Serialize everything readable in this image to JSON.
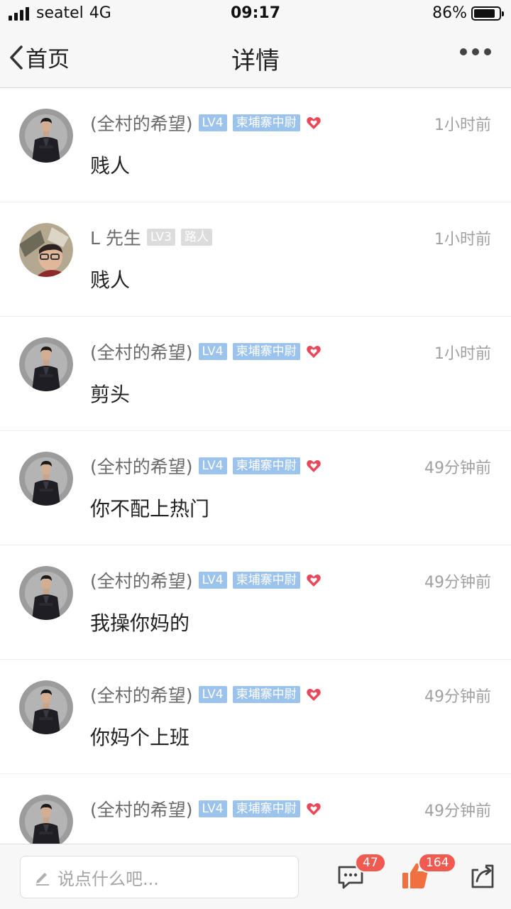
{
  "status_bar": {
    "carrier": "seatel",
    "network": "4G",
    "time": "09:17",
    "battery_percent_text": "86%",
    "battery_level": 0.86
  },
  "nav": {
    "back_label": "首页",
    "title": "详情"
  },
  "comments": [
    {
      "username": "(全村的希望)",
      "level": "LV4",
      "title_badge": "柬埔寨中尉",
      "has_heart": true,
      "time": "1小时前",
      "text": "贱人",
      "avatar": "suit-man"
    },
    {
      "username": "L 先生",
      "level": "LV3",
      "title_badge": "路人",
      "has_heart": false,
      "time": "1小时前",
      "text": "贱人",
      "avatar": "glasses-man"
    },
    {
      "username": "(全村的希望)",
      "level": "LV4",
      "title_badge": "柬埔寨中尉",
      "has_heart": true,
      "time": "1小时前",
      "text": "剪头",
      "avatar": "suit-man"
    },
    {
      "username": "(全村的希望)",
      "level": "LV4",
      "title_badge": "柬埔寨中尉",
      "has_heart": true,
      "time": "49分钟前",
      "text": "你不配上热门",
      "avatar": "suit-man"
    },
    {
      "username": "(全村的希望)",
      "level": "LV4",
      "title_badge": "柬埔寨中尉",
      "has_heart": true,
      "time": "49分钟前",
      "text": "我操你妈的",
      "avatar": "suit-man"
    },
    {
      "username": "(全村的希望)",
      "level": "LV4",
      "title_badge": "柬埔寨中尉",
      "has_heart": true,
      "time": "49分钟前",
      "text": "你妈个上班",
      "avatar": "suit-man"
    },
    {
      "username": "(全村的希望)",
      "level": "LV4",
      "title_badge": "柬埔寨中尉",
      "has_heart": true,
      "time": "49分钟前",
      "text": "",
      "avatar": "suit-man"
    }
  ],
  "bottom_bar": {
    "input_placeholder": "说点什么吧...",
    "comment_count": "47",
    "like_count": "164"
  },
  "colors": {
    "badge_blue": "#9cc3ec",
    "badge_grey": "#dcdcdc",
    "heart_red": "#e8495a",
    "count_badge": "#f05a50",
    "like_orange": "#f07040"
  }
}
